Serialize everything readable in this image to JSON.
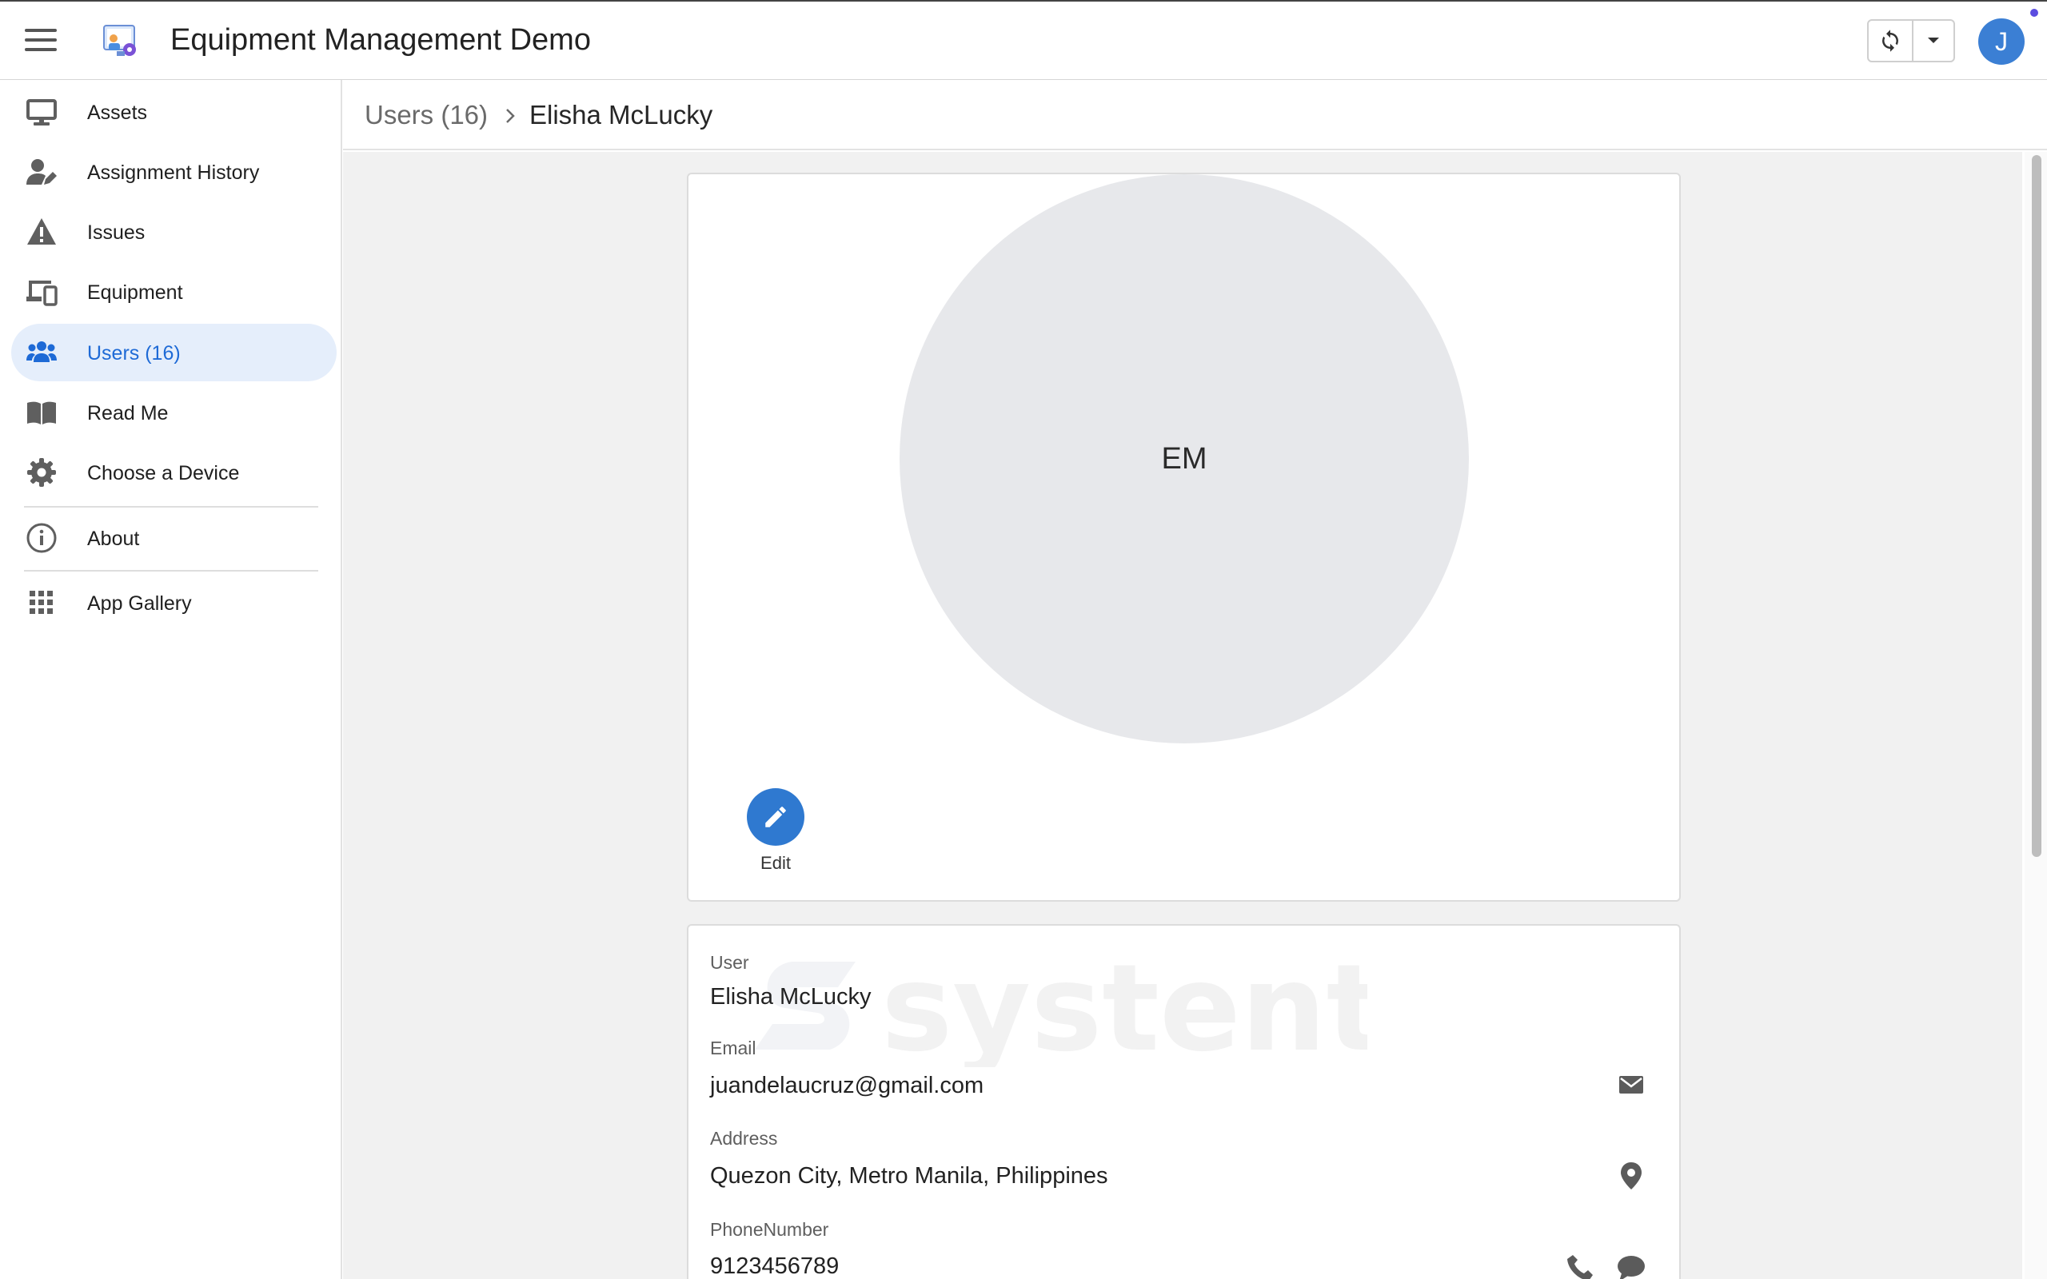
{
  "app": {
    "title": "Equipment Management Demo",
    "avatar_initial": "J",
    "accent_color": "#2f79d0"
  },
  "sidebar": {
    "items": [
      {
        "label": "Assets",
        "icon": "monitor-icon"
      },
      {
        "label": "Assignment History",
        "icon": "user-edit-icon"
      },
      {
        "label": "Issues",
        "icon": "warning-icon"
      },
      {
        "label": "Equipment",
        "icon": "devices-icon"
      },
      {
        "label": "Users (16)",
        "icon": "users-icon",
        "active": true
      },
      {
        "label": "Read Me",
        "icon": "book-icon"
      },
      {
        "label": "Choose a Device",
        "icon": "gear-icon"
      },
      {
        "label": "About",
        "icon": "info-icon"
      },
      {
        "label": "App Gallery",
        "icon": "apps-grid-icon"
      }
    ]
  },
  "breadcrumb": {
    "parent": "Users (16)",
    "current": "Elisha McLucky"
  },
  "profile": {
    "initials": "EM",
    "edit_label": "Edit"
  },
  "details": {
    "watermark": "systent",
    "user_label": "User",
    "user_value": "Elisha McLucky",
    "email_label": "Email",
    "email_value": "juandelaucruz@gmail.com",
    "address_label": "Address",
    "address_value": "Quezon City, Metro Manila, Philippines",
    "phone_label": "PhoneNumber",
    "phone_value": "9123456789"
  }
}
